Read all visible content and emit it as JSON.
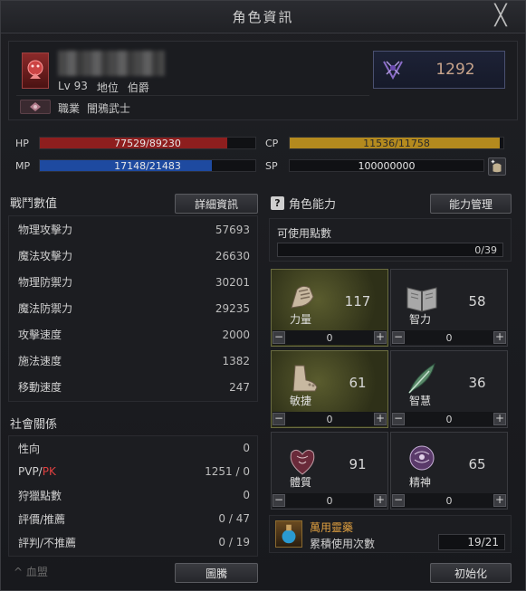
{
  "window": {
    "title": "角色資訊",
    "close_glyph": "╳"
  },
  "profile": {
    "level_label": "Lv",
    "level": "93",
    "rank_label": "地位",
    "rank": "伯爵",
    "job_label": "職業",
    "job": "闇鴉武士",
    "cp": "1292"
  },
  "bars": {
    "hp": {
      "label": "HP",
      "text": "77529/89230",
      "fraction": 0.8689,
      "color": "#8e1e1e"
    },
    "mp": {
      "label": "MP",
      "text": "17148/21483",
      "fraction": 0.7982,
      "color": "#1e4aa0"
    },
    "cp": {
      "label": "CP",
      "text": "11536/11758",
      "fraction": 0.9811,
      "color": "#b48a1e"
    },
    "sp": {
      "label": "SP",
      "text": "100000000"
    }
  },
  "combat": {
    "heading": "戰鬥數值",
    "detail_button": "詳細資訊",
    "rows": [
      {
        "label": "物理攻擊力",
        "value": "57693"
      },
      {
        "label": "魔法攻擊力",
        "value": "26630"
      },
      {
        "label": "物理防禦力",
        "value": "30201"
      },
      {
        "label": "魔法防禦力",
        "value": "29235"
      },
      {
        "label": "攻擊速度",
        "value": "2000"
      },
      {
        "label": "施法速度",
        "value": "1382"
      },
      {
        "label": "移動速度",
        "value": "247"
      }
    ]
  },
  "social": {
    "heading": "社會關係",
    "rows": [
      {
        "label": "性向",
        "value": "0"
      },
      {
        "label_a": "PVP/",
        "label_b": "PK",
        "value": "1251 / 0"
      },
      {
        "label": "狩獵點數",
        "value": "0"
      },
      {
        "label": "評價/推薦",
        "value": "0 / 47"
      },
      {
        "label": "評判/不推薦",
        "value": "0 / 19"
      }
    ],
    "footer_partial": "^ 血盟",
    "emblem_button": "圖騰"
  },
  "abilities": {
    "heading": "角色能力",
    "help_glyph": "?",
    "manage_button": "能力管理",
    "points_label": "可使用點數",
    "points_value": "0/39",
    "items": [
      {
        "name": "力量",
        "value": "117",
        "alloc": "0",
        "icon": "fist-icon",
        "highlight": true
      },
      {
        "name": "智力",
        "value": "58",
        "alloc": "0",
        "icon": "book-icon",
        "highlight": false
      },
      {
        "name": "敏捷",
        "value": "61",
        "alloc": "0",
        "icon": "foot-icon",
        "highlight": true
      },
      {
        "name": "智慧",
        "value": "36",
        "alloc": "0",
        "icon": "feather-icon",
        "highlight": false
      },
      {
        "name": "體質",
        "value": "91",
        "alloc": "0",
        "icon": "heart-icon",
        "highlight": false
      },
      {
        "name": "精神",
        "value": "65",
        "alloc": "0",
        "icon": "mind-icon",
        "highlight": false
      }
    ],
    "plus_glyph": "+",
    "minus_glyph": "−",
    "potion_name": "萬用靈藥",
    "potion_sub": "累積使用次數",
    "potion_count": "19/21",
    "reset_button": "初始化"
  }
}
